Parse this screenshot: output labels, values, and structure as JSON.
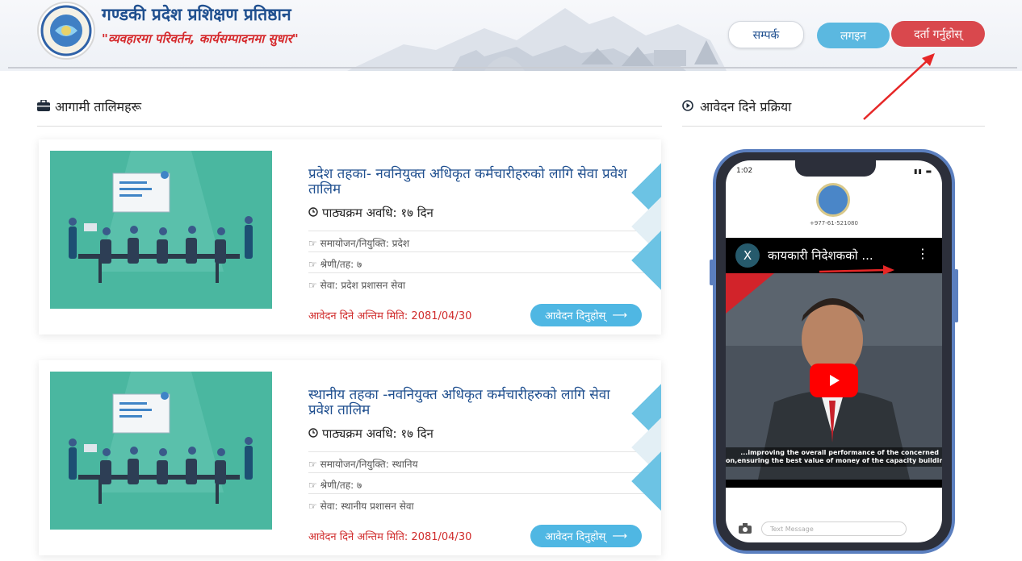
{
  "header": {
    "org_name": "गण्डकी प्रदेश प्रशिक्षण प्रतिष्ठान",
    "slogan": "\"व्यवहारमा परिवर्तन, कार्यसम्पादनमा सुधार\"",
    "nav": {
      "contact": "सम्पर्क",
      "login": "लगइन",
      "register": "दर्ता गर्नुहोस्"
    }
  },
  "upcoming": {
    "title": "आगामी तालिमहरू",
    "icon": "briefcase-icon",
    "trainings": [
      {
        "title": "प्रदेश तहका- नवनियुक्त अधिकृत कर्मचारीहरुको लागि सेवा प्रवेश तालिम",
        "duration": "पाठ्यक्रम अवधि: १७ दिन",
        "appointment": "समायोजन/नियुक्ति: प्रदेश",
        "level": "श्रेणी/तह: ७",
        "service": "सेवा: प्रदेश प्रशासन सेवा",
        "deadline": "आवेदन दिने अन्तिम मिति: 2081/04/30",
        "apply_label": "आवेदन दिनुहोस्"
      },
      {
        "title": "स्थानीय तहका -नवनियुक्त अधिकृत कर्मचारीहरुको लागि सेवा प्रवेश तालिम",
        "duration": "पाठ्यक्रम अवधि: १७ दिन",
        "appointment": "समायोजन/नियुक्ति: स्थानिय",
        "level": "श्रेणी/तह: ७",
        "service": "सेवा: स्थानीय प्रशासन सेवा",
        "deadline": "आवेदन दिने अन्तिम मिति: 2081/04/30",
        "apply_label": "आवेदन दिनुहोस्"
      }
    ]
  },
  "process": {
    "title": "आवेदन दिने प्रक्रिया",
    "icon": "play-circle-icon",
    "phone": {
      "time": "1:02",
      "phone_number": "+977-61-521080",
      "video_badge": "X",
      "video_title": "कायकारी निदेशकको ...",
      "caption_line1": "...improving the overall performance of the concerned",
      "caption_line2": "on,ensuring the best value of money of the capacity building",
      "message_placeholder": "Text Message"
    }
  },
  "colors": {
    "brand_blue": "#1f4f8f",
    "brand_red": "#d5292c",
    "login_blue": "#5bb8e0",
    "register_red": "#d9484d",
    "apply_blue": "#4fb7e3",
    "card_image_teal": "#4ab7a0"
  }
}
